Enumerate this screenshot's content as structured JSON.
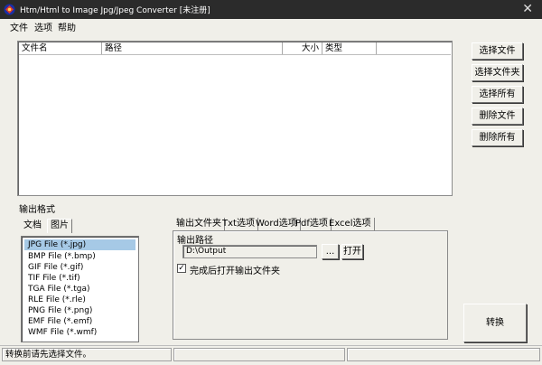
{
  "window": {
    "title": "Htm/Html to Image Jpg/Jpeg Converter [未注册]",
    "close_glyph": "✕"
  },
  "menu": [
    "文件",
    "选项",
    "帮助"
  ],
  "file_list": {
    "columns": [
      "文件名",
      "路径",
      "大小",
      "类型"
    ]
  },
  "side_buttons": [
    "选择文件",
    "选择文件夹",
    "选择所有",
    "删除文件",
    "删除所有"
  ],
  "output_format": {
    "label": "输出格式",
    "tabs": [
      "文档",
      "图片"
    ],
    "formats": [
      "JPG File  (*.jpg)",
      "BMP File  (*.bmp)",
      "GIF File  (*.gif)",
      "TIF File  (*.tif)",
      "TGA File  (*.tga)",
      "RLE File  (*.rle)",
      "PNG File  (*.png)",
      "EMF File  (*.emf)",
      "WMF File  (*.wmf)"
    ],
    "selected_index": 0,
    "selected_color": "#a6c9e6"
  },
  "options": {
    "tabs": [
      "输出文件夹",
      "Txt选项",
      "Word选项",
      "Pdf选项",
      "Excel选项"
    ],
    "output_path_label": "输出路径",
    "output_path_value": "D:\\Output",
    "browse_label": "...",
    "open_label": "打开",
    "open_after_checked": true,
    "check_glyph": "✓",
    "open_after_label": "完成后打开输出文件夹"
  },
  "convert_button": "转换",
  "status": {
    "message": "转换前请先选择文件。",
    "cell2": "",
    "cell3": ""
  },
  "icons": [
    "app-icon",
    "close-icon"
  ],
  "colors": {
    "titlebar_bg": "#2b2b2b",
    "window_bg": "#f0efe9",
    "selection": "#a6c9e6"
  }
}
